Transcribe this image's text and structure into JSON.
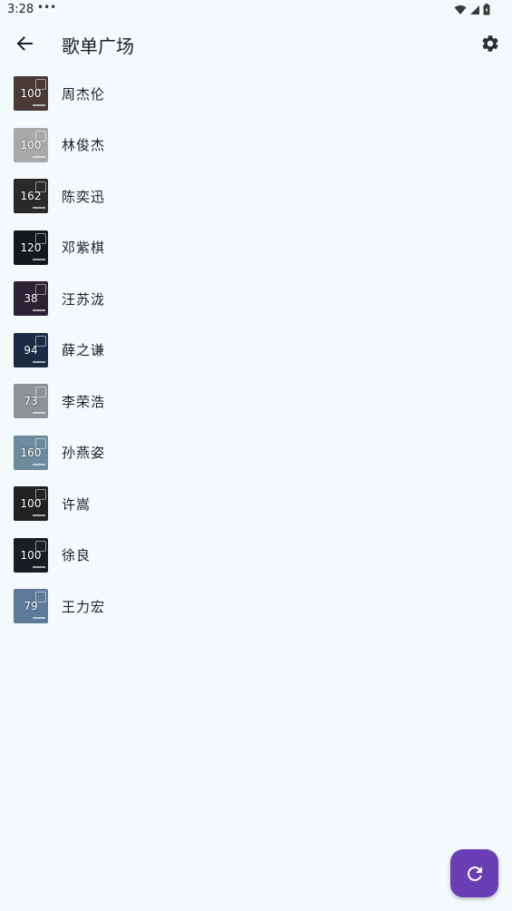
{
  "status_bar": {
    "time": "3:28",
    "dots": "•••"
  },
  "header": {
    "title": "歌单广场"
  },
  "playlists": [
    {
      "name": "周杰伦",
      "count": "100",
      "cover_color": "#4a3a36"
    },
    {
      "name": "林俊杰",
      "count": "100",
      "cover_color": "#a7a9ab"
    },
    {
      "name": "陈奕迅",
      "count": "162",
      "cover_color": "#2a2a2c"
    },
    {
      "name": "邓紫棋",
      "count": "120",
      "cover_color": "#15191c"
    },
    {
      "name": "汪苏泷",
      "count": "38",
      "cover_color": "#2b2233"
    },
    {
      "name": "薛之谦",
      "count": "94",
      "cover_color": "#1e2a44"
    },
    {
      "name": "李荣浩",
      "count": "73",
      "cover_color": "#8d9294"
    },
    {
      "name": "孙燕姿",
      "count": "160",
      "cover_color": "#6b8a9d"
    },
    {
      "name": "许嵩",
      "count": "100",
      "cover_color": "#232220"
    },
    {
      "name": "徐良",
      "count": "100",
      "cover_color": "#1a1d24"
    },
    {
      "name": "王力宏",
      "count": "79",
      "cover_color": "#5c7a9a"
    }
  ],
  "fab": {
    "icon": "refresh-icon",
    "color": "#6a3fb5"
  },
  "colors": {
    "background": "#f4fafb",
    "text": "#1b1f22"
  }
}
